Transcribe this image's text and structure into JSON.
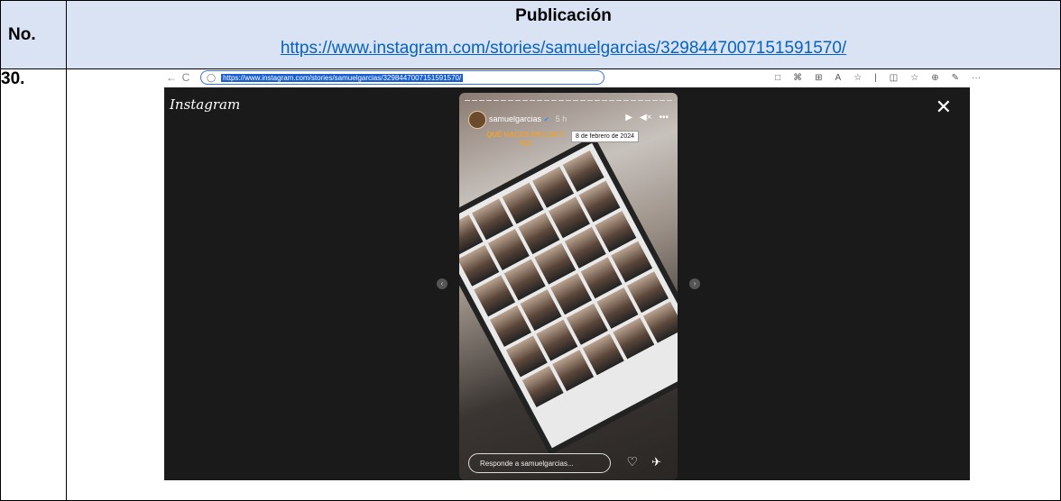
{
  "table": {
    "header_no": "No.",
    "header_pub": "Publicación",
    "header_link": "https://www.instagram.com/stories/samuelgarcias/3298447007151591570/",
    "row_no": "30."
  },
  "browser": {
    "back": "←",
    "reload": "C",
    "lock": "🔒",
    "url": "https://www.instagram.com/stories/samuelgarcias/3298447007151591570/",
    "tools": [
      "□",
      "⌘",
      "⊞",
      "A",
      "☆",
      "|",
      "◫",
      "☆",
      "⊕",
      "✎",
      "···"
    ]
  },
  "instagram": {
    "logo": "Instagram",
    "close": "✕",
    "username": "samuelgarcias",
    "verified": "✔",
    "time": "5 h",
    "tooltip": "8 de febrero de 2024",
    "caption_line1": "QUÉ HACES EN LOS T",
    "caption_line2": "YO!",
    "reply_placeholder": "Responde a samuelgarcias...",
    "play": "▶",
    "sound": "◀×",
    "more": "•••",
    "heart": "♡",
    "send": "✈",
    "prev": "‹",
    "next": "›"
  }
}
